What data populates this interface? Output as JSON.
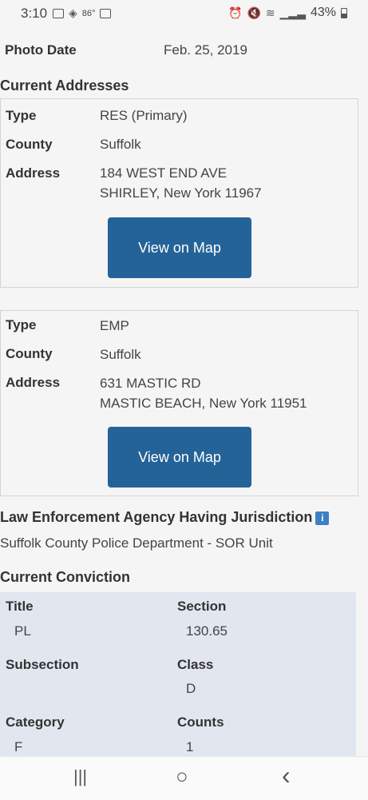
{
  "status_bar": {
    "time": "3:10",
    "temp": "86°",
    "battery": "43%",
    "left_icons": [
      "gmail-icon",
      "feedly-icon",
      "temperature-icon",
      "image-icon"
    ],
    "right_icons": [
      "alarm-icon",
      "mute-icon",
      "wifi-icon",
      "signal-icon",
      "battery-icon"
    ]
  },
  "photo": {
    "label": "Photo Date",
    "value": "Feb. 25, 2019"
  },
  "current_addresses": {
    "heading": "Current Addresses",
    "addresses": [
      {
        "type_label": "Type",
        "type": "RES (Primary)",
        "county_label": "County",
        "county": "Suffolk",
        "address_label": "Address",
        "line1": "184 WEST END AVE",
        "line2": "SHIRLEY, New York 11967",
        "button": "View on Map"
      },
      {
        "type_label": "Type",
        "type": "EMP",
        "county_label": "County",
        "county": "Suffolk",
        "address_label": "Address",
        "line1": "631 MASTIC RD",
        "line2": "MASTIC BEACH, New York 11951",
        "button": "View on Map"
      }
    ]
  },
  "agency": {
    "heading": "Law Enforcement Agency Having Jurisdiction",
    "info_glyph": "i",
    "name": "Suffolk County Police Department - SOR Unit"
  },
  "conviction": {
    "heading": "Current Conviction",
    "title_label": "Title",
    "title": "PL",
    "section_label": "Section",
    "section": "130.65",
    "subsection_label": "Subsection",
    "subsection": "",
    "class_label": "Class",
    "class": "D",
    "category_label": "Category",
    "category": "F",
    "counts_label": "Counts",
    "counts": "1"
  },
  "nav": {
    "recents": "|||",
    "home": "○",
    "back": "‹"
  }
}
